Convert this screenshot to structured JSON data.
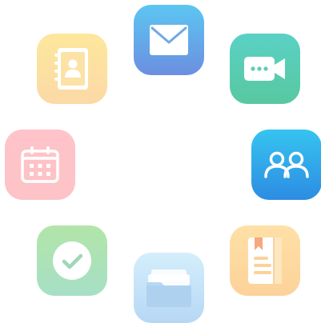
{
  "icons": [
    {
      "id": "mail",
      "glyph": "envelope-icon",
      "color": "#6b8fe0"
    },
    {
      "id": "contacts",
      "glyph": "address-book-icon",
      "color": "#fbd9a6"
    },
    {
      "id": "video",
      "glyph": "video-call-icon",
      "color": "#58c8a0"
    },
    {
      "id": "calendar",
      "glyph": "calendar-icon",
      "color": "#fdc3c6"
    },
    {
      "id": "group",
      "glyph": "people-icon",
      "color": "#2d8ce2"
    },
    {
      "id": "tasks",
      "glyph": "checkmark-icon",
      "color": "#a6dfc6"
    },
    {
      "id": "notes",
      "glyph": "notebook-icon",
      "color": "#fcd29a"
    },
    {
      "id": "files",
      "glyph": "folder-icon",
      "color": "#b6d7f5"
    }
  ]
}
